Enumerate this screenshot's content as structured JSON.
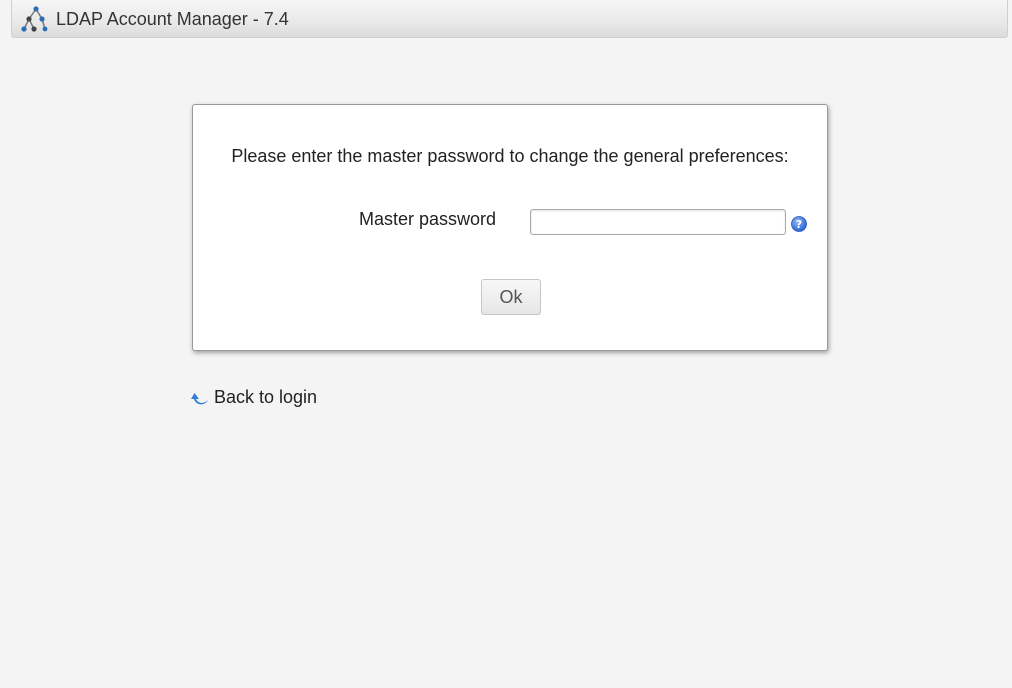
{
  "header": {
    "title": "LDAP Account Manager - 7.4",
    "logo_icon": "ldap-tree-logo-icon"
  },
  "dialog": {
    "prompt": "Please enter the master password to change the general preferences:",
    "password_label": "Master password",
    "password_value": "",
    "help_icon": "help-question-icon",
    "ok_label": "Ok"
  },
  "back_link": {
    "label": "Back to login",
    "icon": "back-arrow-icon"
  },
  "colors": {
    "background": "#f4f4f4",
    "help_blue": "#3b78e7",
    "arrow_blue": "#2f7fd8"
  }
}
